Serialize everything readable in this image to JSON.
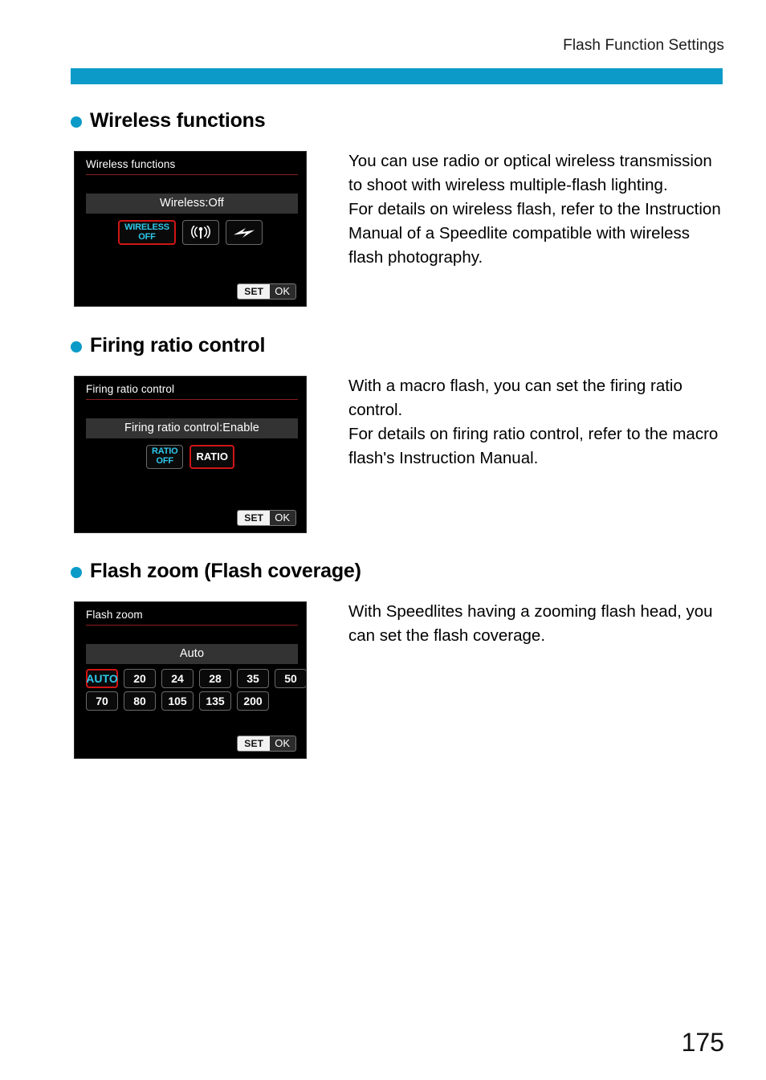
{
  "header": {
    "title": "Flash Function Settings",
    "rule_color": "#0C9BC8"
  },
  "page_number": "175",
  "sections": [
    {
      "heading": "Wireless functions",
      "screen": {
        "title": "Wireless functions",
        "value_bar": "Wireless:Off",
        "options": [
          {
            "label_line1": "WIRELESS",
            "label_line2": "OFF",
            "icon": "wireless-off-text",
            "selected": true,
            "color": "cyan"
          },
          {
            "label_line1": "",
            "label_line2": "",
            "icon": "radio-wave-icon",
            "selected": false,
            "color": "white"
          },
          {
            "label_line1": "",
            "label_line2": "",
            "icon": "flash-bolt-icon",
            "selected": false,
            "color": "white"
          }
        ],
        "set_label": "SET",
        "ok_label": "OK"
      },
      "body": "You can use radio or optical wireless transmission to shoot with wireless multiple-flash lighting.\nFor details on wireless flash, refer to the Instruction Manual of a Speedlite compatible with wireless flash photography."
    },
    {
      "heading": "Firing ratio control",
      "screen": {
        "title": "Firing ratio control",
        "value_bar": "Firing ratio control:Enable",
        "options": [
          {
            "label_line1": "RATIO",
            "label_line2": "OFF",
            "icon": "ratio-off-text",
            "selected": false,
            "color": "cyan"
          },
          {
            "label_line1": "RATIO",
            "label_line2": "",
            "icon": "ratio-text",
            "selected": true,
            "color": "white"
          }
        ],
        "set_label": "SET",
        "ok_label": "OK"
      },
      "body": "With a macro flash, you can set the firing ratio control.\nFor details on firing ratio control, refer to the macro flash's Instruction Manual."
    },
    {
      "heading": "Flash zoom (Flash coverage)",
      "screen": {
        "title": "Flash zoom",
        "value_bar": "Auto",
        "zoom_row1": [
          {
            "label": "AUTO",
            "selected": true,
            "color": "cyan"
          },
          {
            "label": "20",
            "selected": false,
            "color": "white"
          },
          {
            "label": "24",
            "selected": false,
            "color": "white"
          },
          {
            "label": "28",
            "selected": false,
            "color": "white"
          },
          {
            "label": "35",
            "selected": false,
            "color": "white"
          },
          {
            "label": "50",
            "selected": false,
            "color": "white"
          }
        ],
        "zoom_row2": [
          {
            "label": "70",
            "selected": false,
            "color": "white"
          },
          {
            "label": "80",
            "selected": false,
            "color": "white"
          },
          {
            "label": "105",
            "selected": false,
            "color": "white"
          },
          {
            "label": "135",
            "selected": false,
            "color": "white"
          },
          {
            "label": "200",
            "selected": false,
            "color": "white"
          }
        ],
        "set_label": "SET",
        "ok_label": "OK"
      },
      "body": "With Speedlites having a zooming flash head, you can set the flash coverage."
    }
  ]
}
